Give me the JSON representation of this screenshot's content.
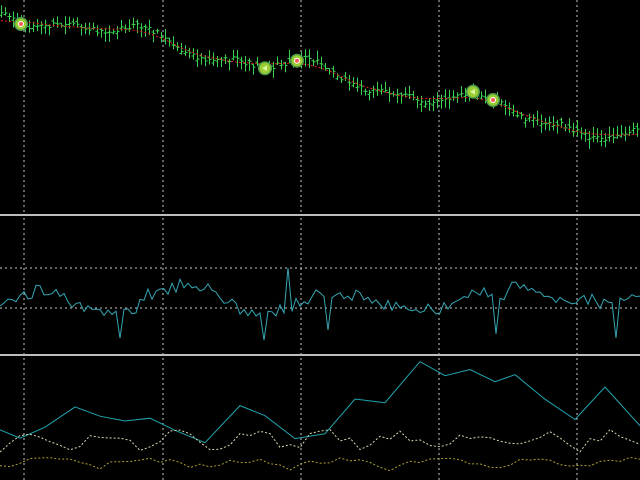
{
  "colors": {
    "background": "#000000",
    "grid": "#c8c8c8",
    "bar": "#39d353",
    "moving_average": "#e11d1d",
    "signal_marker_fill": "#9acd32",
    "signal_marker_ring": "#4e9a4e",
    "signal_marker_center": "#ff5a5a",
    "signal_marker_arrow": "#d9f7a0",
    "oscillator_line": "#35a7b5",
    "indicator_line": "#22a5b0",
    "indicator_dotted_1": "#d8d8b0",
    "indicator_dotted_2": "#b0a030",
    "separator": "#bdbdbd"
  },
  "price_pane": {
    "y_range": [
      0,
      200
    ],
    "bars_count": 160,
    "signal_markers": [
      {
        "bar": 5,
        "icon": "sell-signal-icon"
      },
      {
        "bar": 66,
        "icon": "buy-signal-icon"
      },
      {
        "bar": 74,
        "icon": "sell-signal-icon"
      },
      {
        "bar": 118,
        "icon": "buy-signal-icon"
      },
      {
        "bar": 123,
        "icon": "sell-signal-icon"
      }
    ]
  },
  "oscillator_pane": {
    "level_lines": [
      "upper-level",
      "lower-level"
    ]
  },
  "indicator_pane": {
    "series": [
      "main-line",
      "dotted-line-1",
      "dotted-line-2"
    ]
  }
}
